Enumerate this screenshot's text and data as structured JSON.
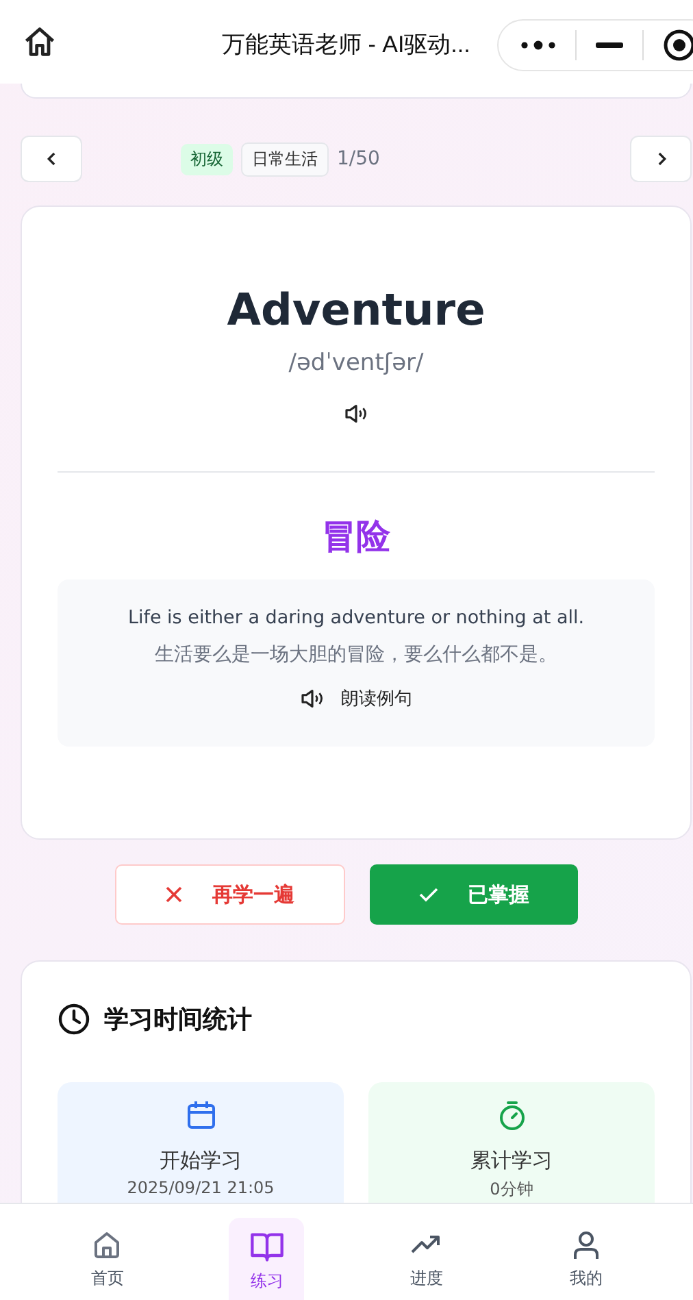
{
  "header": {
    "title": "万能英语老师 - AI驱动..."
  },
  "nav": {
    "level": "初级",
    "category": "日常生活",
    "counter": "1/50"
  },
  "word": {
    "text": "Adventure",
    "phonetic": "/ədˈventʃər/",
    "meaning": "冒险",
    "example_en": "Life is either a daring adventure or nothing at all.",
    "example_zh": "生活要么是一场大胆的冒险，要么什么都不是。",
    "read_label": "朗读例句"
  },
  "actions": [
    {
      "label": "再学一遍",
      "kind": "retry"
    },
    {
      "label": "已掌握",
      "kind": "mastered"
    }
  ],
  "stats": {
    "title": "学习时间统计",
    "items": [
      {
        "kind": "start",
        "label": "开始学习",
        "value": "2025/09/21 21:05"
      },
      {
        "kind": "total",
        "label": "累计学习",
        "value": "0分钟"
      }
    ]
  },
  "tabs": [
    {
      "kind": "home",
      "label": "首页",
      "selected": false
    },
    {
      "kind": "practice",
      "label": "练习",
      "selected": true
    },
    {
      "kind": "progress",
      "label": "进度",
      "selected": false
    },
    {
      "kind": "me",
      "label": "我的",
      "selected": false
    }
  ]
}
